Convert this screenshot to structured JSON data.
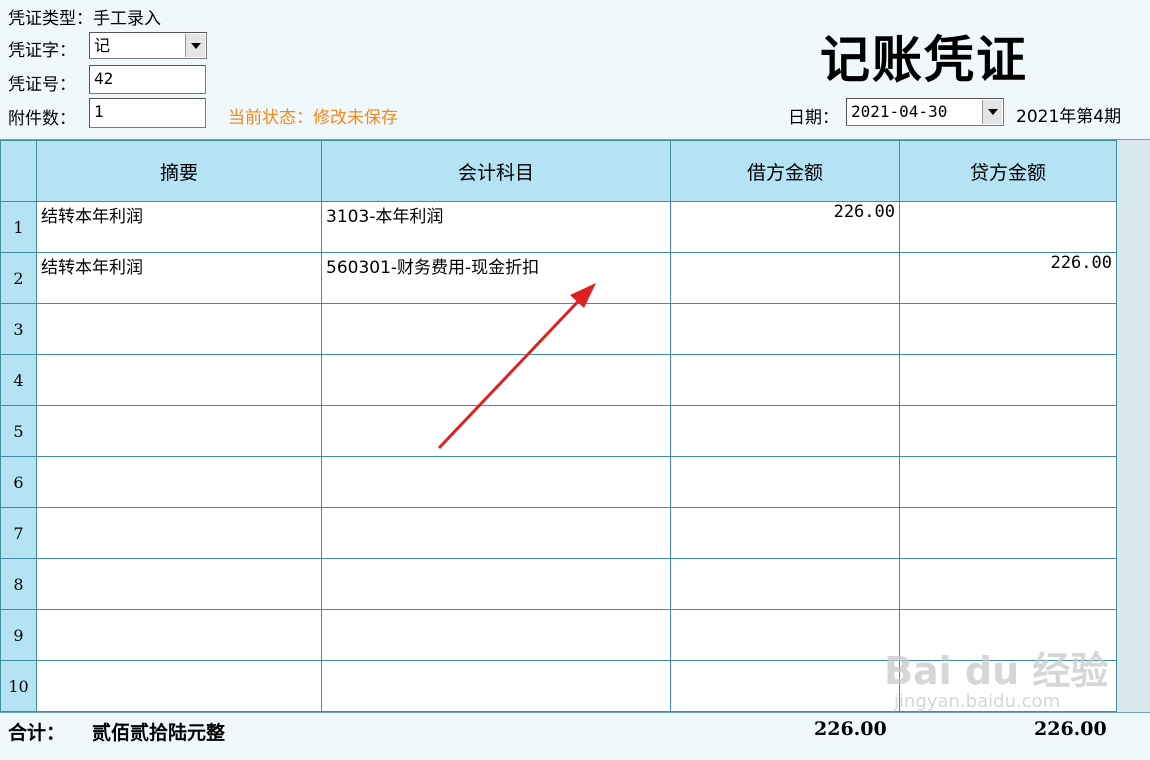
{
  "header": {
    "voucher_type_label": "凭证类型：",
    "voucher_type_value": "手工录入",
    "voucher_word_label": "凭证字：",
    "voucher_word_value": "记",
    "voucher_no_label": "凭证号：",
    "voucher_no_value": "42",
    "attachments_label": "附件数：",
    "attachments_value": "1",
    "status_text": "当前状态：修改未保存",
    "title": "记账凭证",
    "date_label": "日期：",
    "date_value": "2021-04-30",
    "period_text": "2021年第4期"
  },
  "table": {
    "columns": [
      "摘要",
      "会计科目",
      "借方金额",
      "贷方金额"
    ],
    "rows": [
      {
        "num": "1",
        "summary": "结转本年利润",
        "account": "3103-本年利润",
        "debit": "226.00",
        "credit": ""
      },
      {
        "num": "2",
        "summary": "结转本年利润",
        "account": "560301-财务费用-现金折扣",
        "debit": "",
        "credit": "226.00"
      },
      {
        "num": "3",
        "summary": "",
        "account": "",
        "debit": "",
        "credit": ""
      },
      {
        "num": "4",
        "summary": "",
        "account": "",
        "debit": "",
        "credit": ""
      },
      {
        "num": "5",
        "summary": "",
        "account": "",
        "debit": "",
        "credit": ""
      },
      {
        "num": "6",
        "summary": "",
        "account": "",
        "debit": "",
        "credit": ""
      },
      {
        "num": "7",
        "summary": "",
        "account": "",
        "debit": "",
        "credit": ""
      },
      {
        "num": "8",
        "summary": "",
        "account": "",
        "debit": "",
        "credit": ""
      },
      {
        "num": "9",
        "summary": "",
        "account": "",
        "debit": "",
        "credit": ""
      },
      {
        "num": "10",
        "summary": "",
        "account": "",
        "debit": "",
        "credit": ""
      }
    ]
  },
  "footer": {
    "total_label": "合计：",
    "total_words": "贰佰贰拾陆元整",
    "total_debit": "226.00",
    "total_credit": "226.00"
  },
  "watermark": {
    "brand": "Bai du 经验",
    "url": "jingyan.baidu.com"
  },
  "colors": {
    "header_bg": "#b5e3f3",
    "grid_line": "#3e8fa4",
    "status": "#f08a1c",
    "arrow": "#e02020"
  }
}
